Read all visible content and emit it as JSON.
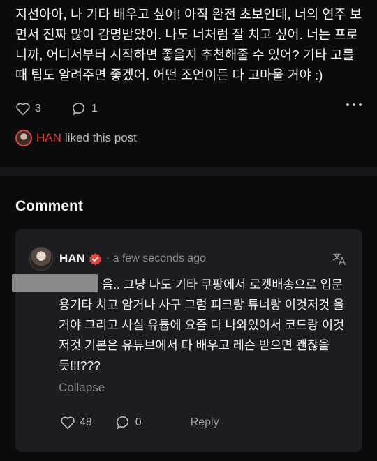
{
  "post": {
    "body": "지선아아, 나 기타 배우고 싶어! 아직 완전 초보인데, 너의 연주 보면서 진짜 많이 감명받았어. 나도 너처럼 잘 치고 싶어. 너는 프로니까, 어디서부터 시작하면 좋을지 추천해줄 수 있어? 기타 고를 때 팁도 알려주면 좋겠어. 어떤 조언이든 다 고마울 거야 :)",
    "likes": "3",
    "comments": "1",
    "liked_by_name": "HAN",
    "liked_by_text": "liked this post"
  },
  "comment_section": {
    "title": "Comment",
    "comment": {
      "author": "HAN",
      "time": "· a few seconds ago",
      "text": "음.. 그냥 나도 기타 쿠팡에서 로켓배송으로 입문용기타 치고 암거나 사구 그럼 피크랑 튜너랑 이것저것 올거야 그리고 사실 유튭에 요즘 다 나와있어서 코드랑 이것저것 기본은 유튜브에서 다 배우고 레슨 받으면 괜찮을듯!!!???",
      "collapse_label": "Collapse",
      "likes": "48",
      "replies": "0",
      "reply_label": "Reply"
    }
  },
  "colors": {
    "accent": "#e0463b",
    "card_bg": "#1d1d21",
    "page_bg": "#0b0b0d"
  }
}
